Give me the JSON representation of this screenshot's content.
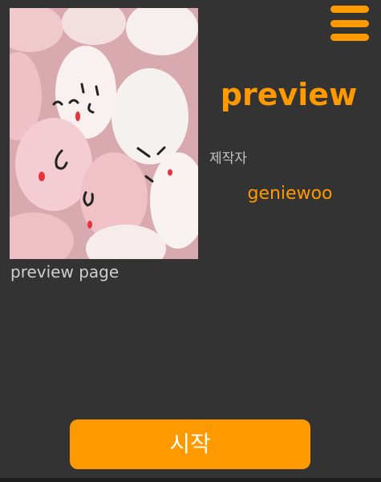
{
  "colors": {
    "background": "#333333",
    "accent": "#FF9900",
    "text_muted": "#cfcfcf"
  },
  "header": {
    "menu_icon": "hamburger-menu-icon"
  },
  "preview": {
    "image_description": "marshmallows",
    "caption": "preview page"
  },
  "info": {
    "title": "preview",
    "maker_label": "제작자",
    "maker_name": "geniewoo"
  },
  "actions": {
    "start_label": "시작"
  }
}
